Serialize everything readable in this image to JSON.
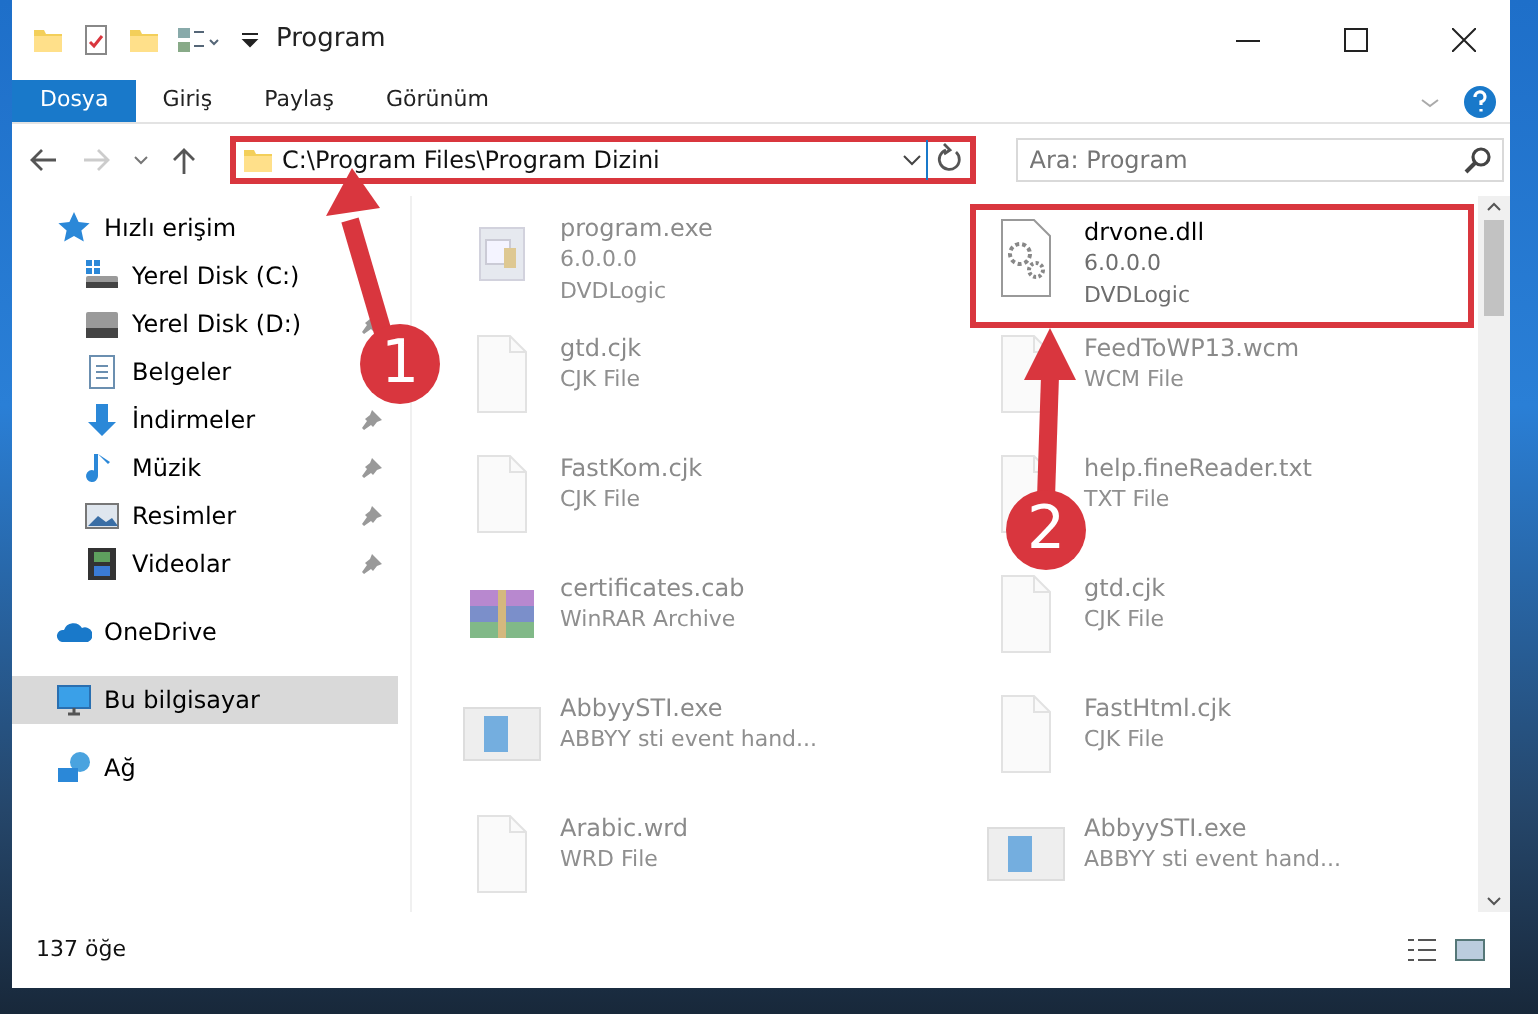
{
  "window": {
    "title": "Program"
  },
  "ribbon_tabs": [
    {
      "label": "Dosya",
      "selected": true
    },
    {
      "label": "Giriş",
      "selected": false
    },
    {
      "label": "Paylaş",
      "selected": false
    },
    {
      "label": "Görünüm",
      "selected": false
    }
  ],
  "address": {
    "path": "C:\\Program Files\\Program Dizini"
  },
  "search": {
    "placeholder": "Ara: Program"
  },
  "nav": [
    {
      "label": "Hızlı erişim",
      "kind": "star",
      "selected": false,
      "children": [
        {
          "label": "Yerel Disk (C:)",
          "kind": "drive-c"
        },
        {
          "label": "Yerel Disk (D:)",
          "kind": "drive",
          "pinned": true
        },
        {
          "label": "Belgeler",
          "kind": "documents"
        },
        {
          "label": "İndirmeler",
          "kind": "downloads",
          "pinned": true
        },
        {
          "label": "Müzik",
          "kind": "music",
          "pinned": true
        },
        {
          "label": "Resimler",
          "kind": "pictures",
          "pinned": true
        },
        {
          "label": "Videolar",
          "kind": "videos",
          "pinned": true
        }
      ]
    },
    {
      "label": "OneDrive",
      "kind": "cloud",
      "selected": false
    },
    {
      "label": "Bu bilgisayar",
      "kind": "pc",
      "selected": true
    },
    {
      "label": "Ağ",
      "kind": "network",
      "selected": false
    }
  ],
  "files": [
    {
      "name": "program.exe",
      "lines": [
        "6.0.0.0",
        "DVDLogic"
      ],
      "kind": "app",
      "highlighted": false
    },
    {
      "name": "drvone.dll",
      "lines": [
        "6.0.0.0",
        "DVDLogic"
      ],
      "kind": "dll",
      "highlighted": true
    },
    {
      "name": "gtd.cjk",
      "lines": [
        "CJK File"
      ],
      "kind": "doc",
      "highlighted": false
    },
    {
      "name": "FeedToWP13.wcm",
      "lines": [
        "WCM File"
      ],
      "kind": "doc",
      "highlighted": false
    },
    {
      "name": "FastKom.cjk",
      "lines": [
        "CJK File"
      ],
      "kind": "doc",
      "highlighted": false
    },
    {
      "name": "help.fineReader.txt",
      "lines": [
        "TXT File"
      ],
      "kind": "doc",
      "highlighted": false
    },
    {
      "name": "certificates.cab",
      "lines": [
        "WinRAR Archive"
      ],
      "kind": "archive",
      "highlighted": false
    },
    {
      "name": "gtd.cjk",
      "lines": [
        "CJK File"
      ],
      "kind": "doc",
      "highlighted": false
    },
    {
      "name": "AbbyySTI.exe",
      "lines": [
        "ABBYY sti event hand..."
      ],
      "kind": "window",
      "highlighted": false
    },
    {
      "name": "FastHtml.cjk",
      "lines": [
        "CJK File"
      ],
      "kind": "doc",
      "highlighted": false
    },
    {
      "name": "Arabic.wrd",
      "lines": [
        "WRD File"
      ],
      "kind": "doc",
      "highlighted": false
    },
    {
      "name": "AbbyySTI.exe",
      "lines": [
        "ABBYY sti event hand..."
      ],
      "kind": "window",
      "highlighted": false
    }
  ],
  "status_bar": {
    "count": "137 öğe"
  },
  "callouts": [
    {
      "label": "1"
    },
    {
      "label": "2"
    }
  ]
}
